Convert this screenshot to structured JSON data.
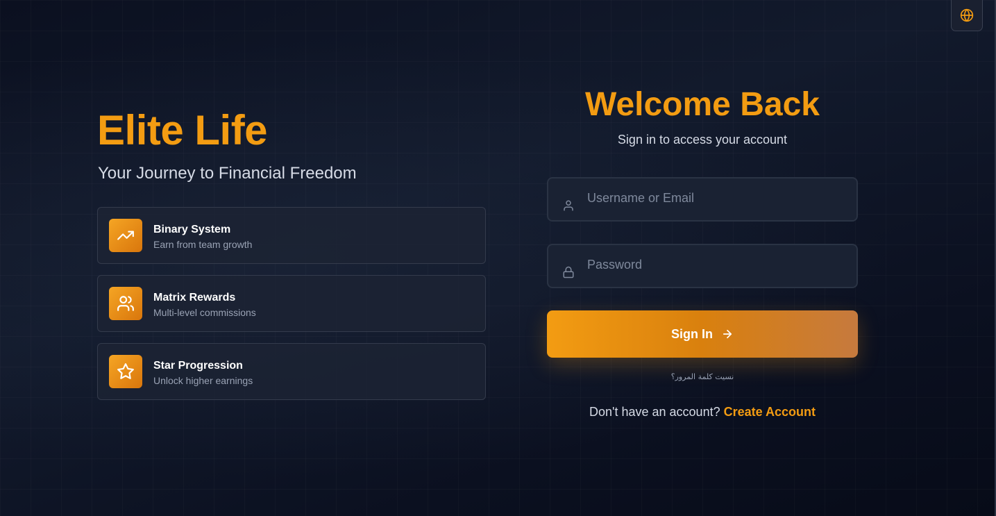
{
  "brand": {
    "title": "Elite Life",
    "subtitle": "Your Journey to Financial Freedom"
  },
  "features": [
    {
      "icon": "trending-up-icon",
      "title": "Binary System",
      "description": "Earn from team growth"
    },
    {
      "icon": "users-icon",
      "title": "Matrix Rewards",
      "description": "Multi-level commissions"
    },
    {
      "icon": "star-icon",
      "title": "Star Progression",
      "description": "Unlock higher earnings"
    }
  ],
  "login": {
    "heading": "Welcome Back",
    "subheading": "Sign in to access your account",
    "username_placeholder": "Username or Email",
    "username_value": "",
    "password_placeholder": "Password",
    "password_value": "",
    "submit_label": "Sign In",
    "forgot_label": "نسيت كلمة المرور؟",
    "signup_prompt": "Don't have an account?",
    "signup_link": "Create Account"
  },
  "header": {
    "language_icon": "globe-icon"
  },
  "colors": {
    "accent": "#f39c12",
    "background": "#0b1020",
    "card": "#1c2334"
  }
}
